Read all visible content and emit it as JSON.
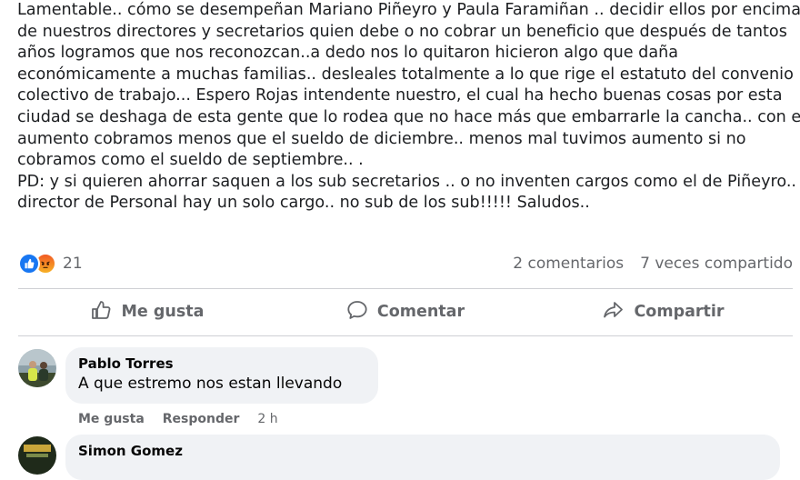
{
  "post": {
    "lines": [
      "Lamentable.. cómo se desempeñan Mariano Piñeyro y Paula Faramiñan .. decidir ellos por encima",
      "de nuestros directores y secretarios quien debe o no cobrar un beneficio que después de tantos",
      "años logramos que nos reconozcan..a dedo nos lo quitaron hicieron algo que daña",
      "económicamente a muchas familias.. desleales totalmente a lo que rige el estatuto del convenio",
      "colectivo de trabajo... Espero Rojas intendente nuestro, el cual ha hecho buenas cosas por esta",
      "ciudad se deshaga de esta gente que lo rodea que no hace más que embarrarle la cancha.. con el",
      "aumento cobramos menos que el sueldo de diciembre.. menos mal tuvimos aumento si no",
      "cobramos como el sueldo de septiembre.. .",
      "PD: y si quieren ahorrar saquen a los sub secretarios .. o no inventen cargos como el de Piñeyro..",
      "director de Personal hay un solo cargo.. no sub de los sub!!!!! Saludos.."
    ]
  },
  "stats": {
    "reaction_count": "21",
    "comments_label": "2 comentarios",
    "shares_label": "7 veces compartido",
    "reaction_icons": [
      "like-icon",
      "angry-icon"
    ],
    "colors": {
      "like": "#1877f2",
      "angry": "#f15a24",
      "muted": "#65676b"
    }
  },
  "actions": {
    "like_label": "Me gusta",
    "comment_label": "Comentar",
    "share_label": "Compartir"
  },
  "comments": [
    {
      "author": "Pablo Torres",
      "text": "A que estremo nos estan llevando",
      "like_label": "Me gusta",
      "reply_label": "Responder",
      "time": "2 h"
    },
    {
      "author": "Simon Gomez"
    }
  ]
}
